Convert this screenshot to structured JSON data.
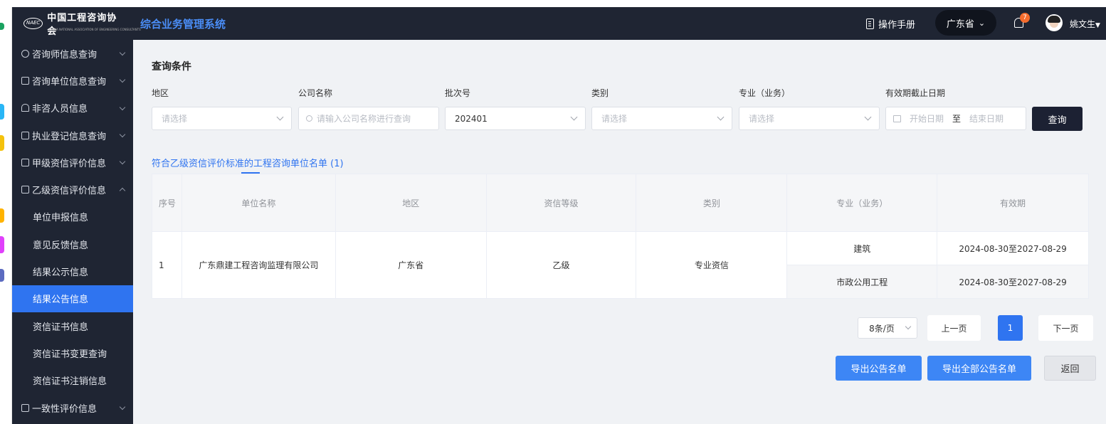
{
  "header": {
    "logo_text": "中国工程咨询协会",
    "logo_mark": "NAEC",
    "logo_en": "CHINA NATIONAL ASSOCIATION OF ENGINEERING CONSULTANTS",
    "system_title": "综合业务管理系统",
    "manual_label": "操作手册",
    "province": "广东省",
    "notification_count": "7",
    "user_name": "姚文生"
  },
  "sidebar": {
    "items": [
      {
        "label": "咨询师信息查询"
      },
      {
        "label": "咨询单位信息查询"
      },
      {
        "label": "非咨人员信息"
      },
      {
        "label": "执业登记信息查询"
      },
      {
        "label": "甲级资信评价信息"
      },
      {
        "label": "乙级资信评价信息"
      }
    ],
    "sub_items": [
      {
        "label": "单位申报信息"
      },
      {
        "label": "意见反馈信息"
      },
      {
        "label": "结果公示信息"
      },
      {
        "label": "结果公告信息"
      },
      {
        "label": "资信证书信息"
      },
      {
        "label": "资信证书变更查询"
      },
      {
        "label": "资信证书注销信息"
      }
    ],
    "last_item": {
      "label": "一致性评价信息"
    }
  },
  "query": {
    "title": "查询条件",
    "region_label": "地区",
    "region_placeholder": "请选择",
    "company_label": "公司名称",
    "company_placeholder": "请输入公司名称进行查询",
    "batch_label": "批次号",
    "batch_value": "202401",
    "category_label": "类别",
    "category_placeholder": "请选择",
    "major_label": "专业（业务）",
    "major_placeholder": "请选择",
    "validity_label": "有效期截止日期",
    "start_placeholder": "开始日期",
    "range_sep": "至",
    "end_placeholder": "结束日期",
    "search_button": "查询"
  },
  "list": {
    "tab_title": "符合乙级资信评价标准的工程咨询单位名单 (1)",
    "columns": [
      "序号",
      "单位名称",
      "地区",
      "资信等级",
      "类别",
      "专业（业务）",
      "有效期"
    ],
    "rows": [
      {
        "index": "1",
        "company": "广东鼎建工程咨询监理有限公司",
        "region": "广东省",
        "grade": "乙级",
        "category": "专业资信",
        "majors": [
          {
            "name": "建筑",
            "validity": "2024-08-30至2027-08-29"
          },
          {
            "name": "市政公用工程",
            "validity": "2024-08-30至2027-08-29"
          }
        ]
      }
    ]
  },
  "pagination": {
    "page_size": "8条/页",
    "prev": "上一页",
    "current": "1",
    "next": "下一页"
  },
  "actions": {
    "export": "导出公告名单",
    "export_all": "导出全部公告名单",
    "back": "返回"
  }
}
